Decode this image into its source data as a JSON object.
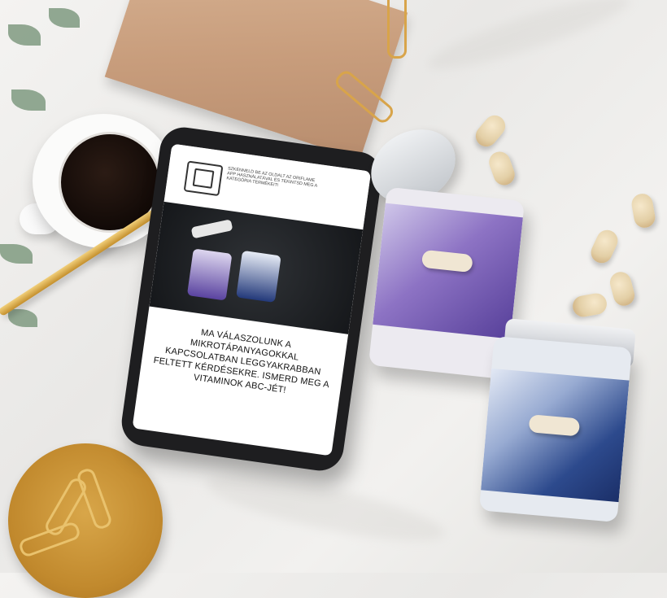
{
  "phone": {
    "qr_instruction": "SZKENNELD BE AZ OLDALT AZ ORIFLAME APP HASZNÁLATÁVAL ÉS TEKINTSD MEG A KATEGÓRIA TERMÉKEIT!",
    "headline": "MA VÁLASZOLUNK A MIKROTÁPANYAGOKKAL KAPCSOLATBAN LEGGYAKRABBAN FELTETT KÉRDÉSEKRE. ISMERD MEG A VITAMINOK ABC-JÉT!"
  },
  "colors": {
    "jar_purple": "#57409a",
    "jar_blue": "#1b2f68",
    "gold": "#c48f2c",
    "coffee": "#120a07"
  }
}
